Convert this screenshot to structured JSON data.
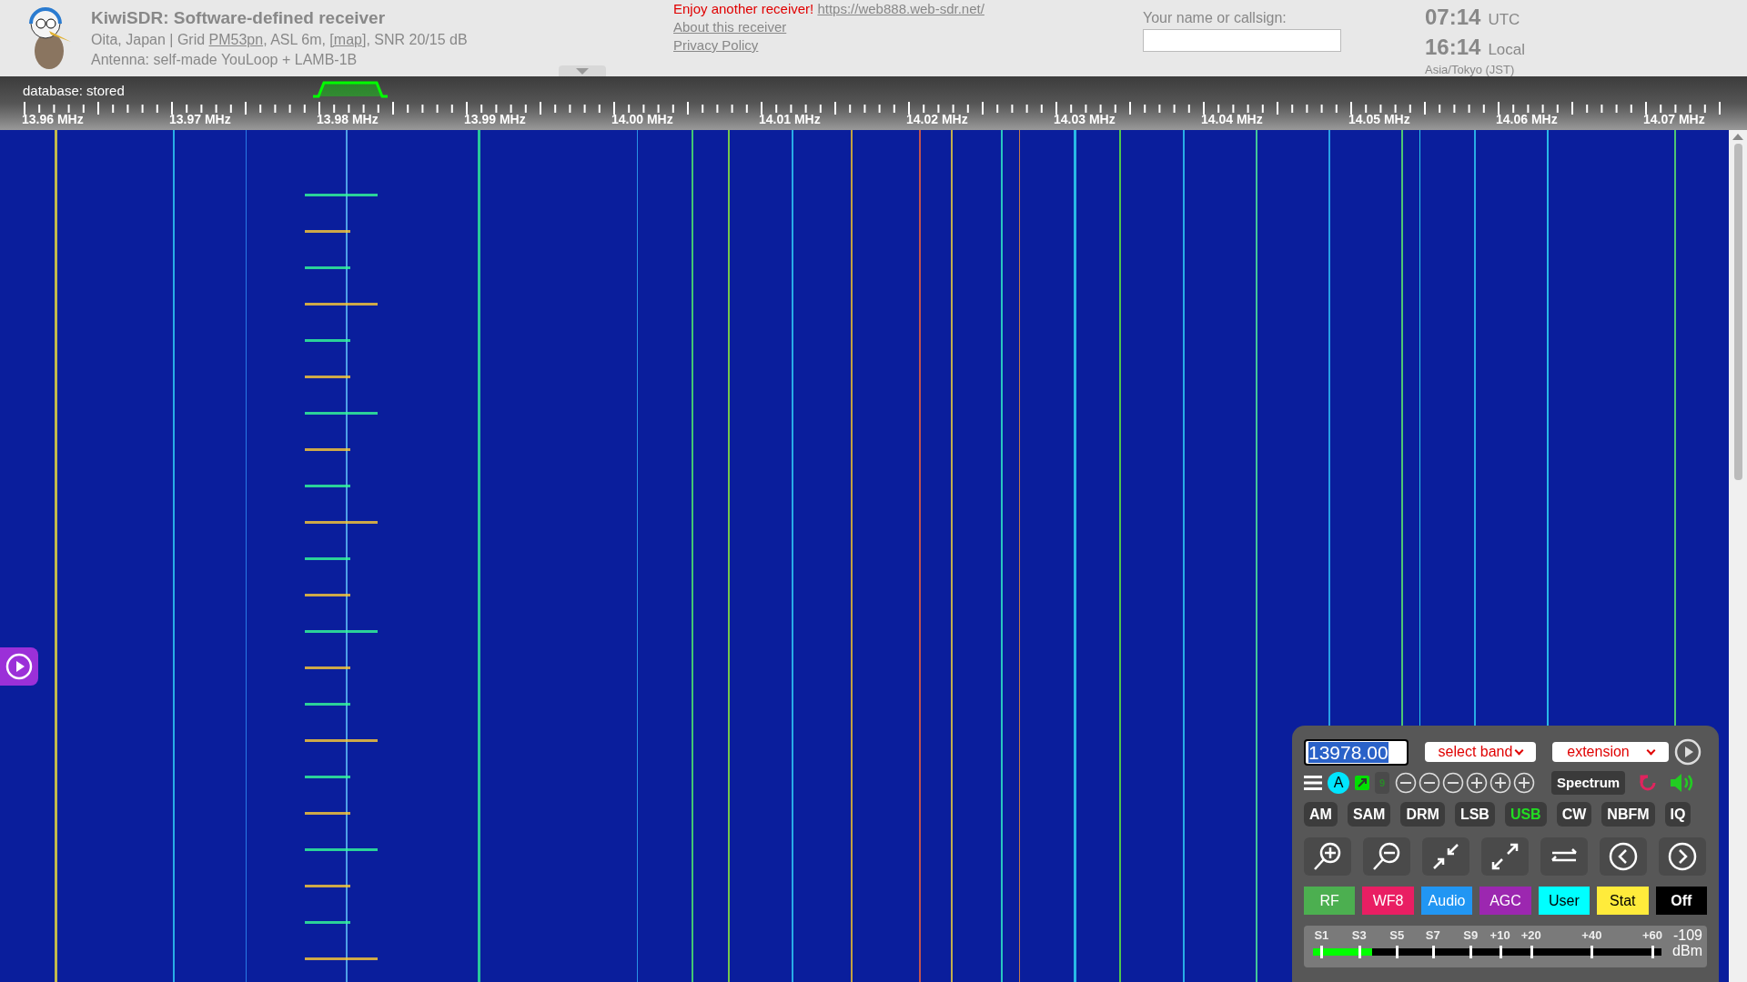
{
  "header": {
    "title": "KiwiSDR: Software-defined receiver",
    "location_parts": [
      {
        "text": "Oita, Japan | Grid ",
        "link": false
      },
      {
        "text": "PM53pn",
        "link": true
      },
      {
        "text": ", ASL 6m, ",
        "link": false
      },
      {
        "text": "[map]",
        "link": true
      },
      {
        "text": ", SNR 20/15 dB",
        "link": false
      }
    ],
    "antenna": "Antenna: self-made YouLoop + LAMB-1B",
    "promo": "Enjoy another receiver!",
    "promo_link": "https://web888.web-sdr.net/",
    "links": [
      "About this receiver",
      "Privacy Policy"
    ],
    "callsign": {
      "label": "Your name or callsign:"
    },
    "clocks": [
      {
        "time": "07:14",
        "zone": "UTC"
      },
      {
        "time": "16:14",
        "zone": "Local"
      }
    ],
    "timezone": "Asia/Tokyo (JST)"
  },
  "scale": {
    "status": "database: stored",
    "labels": [
      "13.96 MHz",
      "13.97 MHz",
      "13.98 MHz",
      "13.99 MHz",
      "14.00 MHz",
      "14.01 MHz",
      "14.02 MHz",
      "14.03 MHz",
      "14.04 MHz",
      "14.05 MHz",
      "14.06 MHz",
      "14.07 MHz"
    ]
  },
  "panel": {
    "frequency": "13978.00",
    "band_select": "select band",
    "extension_select": "extension",
    "badge": "A",
    "step": "9",
    "spectrum": "Spectrum",
    "modes": [
      {
        "label": "AM",
        "selected": false
      },
      {
        "label": "SAM",
        "selected": false
      },
      {
        "label": "DRM",
        "selected": false
      },
      {
        "label": "LSB",
        "selected": false
      },
      {
        "label": "USB",
        "selected": true
      },
      {
        "label": "CW",
        "selected": false
      },
      {
        "label": "NBFM",
        "selected": false
      },
      {
        "label": "IQ",
        "selected": false
      }
    ],
    "tabs": [
      {
        "label": "RF",
        "color": "#4caf50"
      },
      {
        "label": "WF8",
        "color": "#e91e63"
      },
      {
        "label": "Audio",
        "color": "#2196f3"
      },
      {
        "label": "AGC",
        "color": "#9c27b0"
      },
      {
        "label": "User",
        "color": "#00ffff"
      },
      {
        "label": "Stat",
        "color": "#ffeb3b"
      },
      {
        "label": "Off",
        "color": "#000000"
      }
    ],
    "smeter": {
      "labels": [
        "S1",
        "S3",
        "S5",
        "S7",
        "S9",
        "+10",
        "+20",
        "+40",
        "+60"
      ],
      "level": 0.17,
      "reading": "-109",
      "unit": "dBm"
    }
  }
}
